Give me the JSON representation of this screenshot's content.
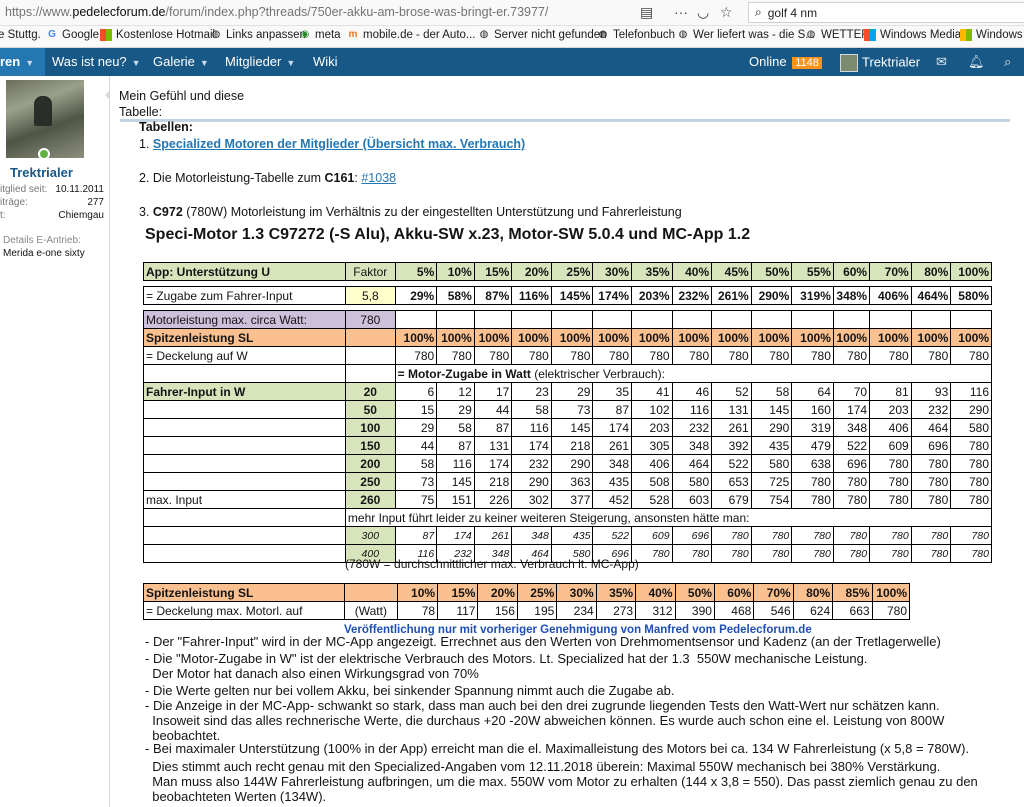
{
  "browser": {
    "url_prefix": "https://www.",
    "url_domain": "pedelecforum.de",
    "url_path": "/forum/index.php?threads/750er-akku-am-brose-was-bringt-er.73977/",
    "search_query": "golf 4 nm",
    "bookmarks": [
      "e Stuttg.",
      "Google",
      "Kostenlose Hotmail",
      "Links anpassen",
      "meta",
      "mobile.de - der Auto...",
      "Server nicht gefunden",
      "Telefonbuch",
      "Wer liefert was - die S...",
      "WETTER",
      "Windows Media",
      "Windows"
    ]
  },
  "nav": {
    "active": "ren",
    "items": [
      "Was ist neu?",
      "Galerie",
      "Mitglieder",
      "Wiki"
    ],
    "online_label": "Online",
    "online_count": "1148",
    "user": "Trektrialer"
  },
  "sidebar": {
    "username": "Trektrialer",
    "meta": [
      {
        "k": "itglied seit:",
        "v": "10.11.2011"
      },
      {
        "k": "iträge:",
        "v": "277"
      },
      {
        "k": "t:",
        "v": "Chiemgau"
      }
    ],
    "ebike_label": "Details E-Antrieb:",
    "ebike_value": "Merida e-one sixty"
  },
  "post": {
    "line1": "Mein Gefühl und diese",
    "line2": "Tabelle:",
    "tabellen": "Tabellen:",
    "item1_num": "1. ",
    "item1_link": "Specialized Motoren der Mitglieder (Übersicht max. Verbrauch)",
    "item2_pre": "2. Die Motorleistung-Tabelle zum ",
    "item2_bold": "C161",
    "item2_mid": ": ",
    "item2_link": "#1038",
    "item3_pre": "3. ",
    "item3_bold": "C972",
    "item3_rest": " (780W) Motorleistung im Verhältnis zu der eingestellten Unterstützung und Fahrerleistung"
  },
  "table": {
    "title": "Speci-Motor 1.3 C97272  (-S Alu), Akku-SW x.23,  Motor-SW 5.0.4 und MC-App 1.2",
    "hdr_label": "App: Unterstützung U",
    "faktor_label": "Faktor",
    "percents": [
      "5%",
      "10%",
      "15%",
      "20%",
      "25%",
      "30%",
      "35%",
      "40%",
      "45%",
      "50%",
      "55%",
      "60%",
      "70%",
      "80%",
      "100%"
    ],
    "zugabe_label": "= Zugabe zum Fahrer-Input",
    "faktor_value": "5,8",
    "zugabe_values": [
      "29%",
      "58%",
      "87%",
      "116%",
      "145%",
      "174%",
      "203%",
      "232%",
      "261%",
      "290%",
      "319%",
      "348%",
      "406%",
      "464%",
      "580%"
    ],
    "motor_max_label": "Motorleistung max. circa Watt:",
    "motor_max_value": "780",
    "spitzen_label": "Spitzenleistung SL",
    "spitzen_values": [
      "100%",
      "100%",
      "100%",
      "100%",
      "100%",
      "100%",
      "100%",
      "100%",
      "100%",
      "100%",
      "100%",
      "100%",
      "100%",
      "100%",
      "100%"
    ],
    "deckel_label": "= Deckelung auf W",
    "deckel_values": [
      "780",
      "780",
      "780",
      "780",
      "780",
      "780",
      "780",
      "780",
      "780",
      "780",
      "780",
      "780",
      "780",
      "780",
      "780"
    ],
    "zugabe_watt_bold": "= Motor-Zugabe in Watt",
    "zugabe_watt_rest": " (elektrischer Verbrauch):",
    "fahrer_label": "Fahrer-Input in W",
    "maxinput_label": "max. Input",
    "rows": [
      {
        "in": "20",
        "v": [
          "6",
          "12",
          "17",
          "23",
          "29",
          "35",
          "41",
          "46",
          "52",
          "58",
          "64",
          "70",
          "81",
          "93",
          "116"
        ]
      },
      {
        "in": "50",
        "v": [
          "15",
          "29",
          "44",
          "58",
          "73",
          "87",
          "102",
          "116",
          "131",
          "145",
          "160",
          "174",
          "203",
          "232",
          "290"
        ]
      },
      {
        "in": "100",
        "v": [
          "29",
          "58",
          "87",
          "116",
          "145",
          "174",
          "203",
          "232",
          "261",
          "290",
          "319",
          "348",
          "406",
          "464",
          "580"
        ]
      },
      {
        "in": "150",
        "v": [
          "44",
          "87",
          "131",
          "174",
          "218",
          "261",
          "305",
          "348",
          "392",
          "435",
          "479",
          "522",
          "609",
          "696",
          "780"
        ]
      },
      {
        "in": "200",
        "v": [
          "58",
          "116",
          "174",
          "232",
          "290",
          "348",
          "406",
          "464",
          "522",
          "580",
          "638",
          "696",
          "780",
          "780",
          "780"
        ]
      },
      {
        "in": "250",
        "v": [
          "73",
          "145",
          "218",
          "290",
          "363",
          "435",
          "508",
          "580",
          "653",
          "725",
          "780",
          "780",
          "780",
          "780",
          "780"
        ]
      },
      {
        "in": "260",
        "v": [
          "75",
          "151",
          "226",
          "302",
          "377",
          "452",
          "528",
          "603",
          "679",
          "754",
          "780",
          "780",
          "780",
          "780",
          "780"
        ]
      }
    ],
    "more_input_note": "mehr Input führt leider zu keiner weiteren Steigerung, ansonsten hätte man:",
    "rows_it": [
      {
        "in": "300",
        "v": [
          "87",
          "174",
          "261",
          "348",
          "435",
          "522",
          "609",
          "696",
          "780",
          "780",
          "780",
          "780",
          "780",
          "780",
          "780"
        ]
      },
      {
        "in": "400",
        "v": [
          "116",
          "232",
          "348",
          "464",
          "580",
          "696",
          "780",
          "780",
          "780",
          "780",
          "780",
          "780",
          "780",
          "780",
          "780"
        ]
      }
    ],
    "avg_note": "(780W = durchschnittlicher max. Verbrauch lt. MC-App)",
    "t2_label": "Spitzenleistung SL",
    "t2_percents": [
      "10%",
      "15%",
      "20%",
      "25%",
      "30%",
      "35%",
      "40%",
      "50%",
      "60%",
      "70%",
      "80%",
      "85%",
      "100%"
    ],
    "t2_deckel_label": "= Deckelung max. Motorl. auf",
    "t2_watt": "(Watt)",
    "t2_values": [
      "78",
      "117",
      "156",
      "195",
      "234",
      "273",
      "312",
      "390",
      "468",
      "546",
      "624",
      "663",
      "780"
    ]
  },
  "notes": {
    "publication": "Veröffentlichung nur mit vorheriger Genehmigung von Manfred vom Pedelecforum.de",
    "lines": [
      "- Der \"Fahrer-Input\" wird in der MC-App angezeigt. Errechnet aus den Werten von Drehmomentsensor und Kadenz (an der Tretlagerwelle)",
      "- Die \"Motor-Zugabe in W\" ist der elektrische Verbrauch des Motors. Lt. Specialized hat der 1.3  550W mechanische Leistung.",
      "  Der Motor hat danach also einen Wirkungsgrad von 70%",
      "- Die Werte gelten nur bei vollem Akku, bei sinkender Spannung nimmt auch die Zugabe ab.",
      "- Die Anzeige in der MC-App- schwankt so stark, dass man auch bei den drei zugrunde liegenden Tests den Watt-Wert nur schätzen kann.",
      "  Insoweit sind das alles rechnerische Werte, die durchaus +20 -20W abweichen können. Es wurde auch schon eine el. Leistung von 800W",
      "  beobachtet.",
      "- Bei maximaler Unterstützung (100% in der App) erreicht man die el. Maximalleistung des Motors bei ca. 134 W Fahrerleistung (x 5,8 = 780W).",
      "  Dies stimmt auch recht genau mit den Specialized-Angaben vom 12.11.2018 überein: Maximal 550W mechanisch bei 380% Verstärkung.",
      "  Man muss also 144W Fahrerleistung aufbringen, um die max. 550W vom Motor zu erhalten (144 x 3,8 = 550). Das passt ziemlich genau zu den",
      "  beobachteten Werten (134W)."
    ]
  }
}
